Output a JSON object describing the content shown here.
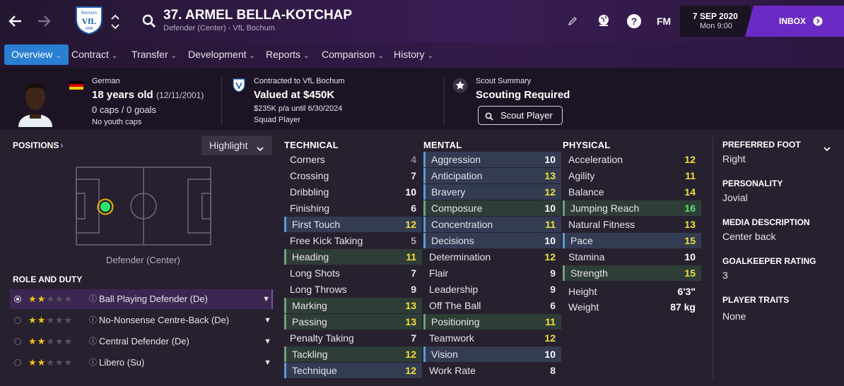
{
  "header": {
    "player_name": "37. ARMEL BELLA-KOTCHAP",
    "subtitle": "Defender (Center) - VfL Bochum",
    "fm_label": "FM",
    "date": "7 SEP 2020",
    "time": "Mon 9:00",
    "inbox_label": "INBOX",
    "club_crest_text_top": "Bochum",
    "club_crest_text_bottom": "1848",
    "club_crest_letters": "VfL"
  },
  "nav": {
    "tabs": [
      {
        "label": "Overview"
      },
      {
        "label": "Contract"
      },
      {
        "label": "Transfer"
      },
      {
        "label": "Development"
      },
      {
        "label": "Reports"
      },
      {
        "label": "Comparison"
      },
      {
        "label": "History"
      }
    ]
  },
  "info": {
    "nationality": "German",
    "age": "18 years old",
    "dob": "(12/11/2001)",
    "caps": "0 caps / 0 goals",
    "youth_caps": "No youth caps",
    "contract_to": "Contracted to VfL Bochum",
    "value": "Valued at $450K",
    "wage": "$235K p/a until 6/30/2024",
    "squad_status": "Squad Player",
    "scout_title": "Scout Summary",
    "scout_status": "Scouting Required",
    "scout_button": "Scout Player"
  },
  "positions": {
    "header": "POSITIONS",
    "highlight_label": "Highlight",
    "position_label": "Defender (Center)"
  },
  "role_duty": {
    "header": "ROLE AND DUTY",
    "rows": [
      {
        "label": "Ball Playing Defender (De)",
        "stars": 2
      },
      {
        "label": "No-Nonsense Centre-Back (De)",
        "stars": 2
      },
      {
        "label": "Central Defender (De)",
        "stars": 2
      },
      {
        "label": "Libero (Su)",
        "stars": 2
      }
    ]
  },
  "technical": {
    "header": "TECHNICAL",
    "attrs": [
      {
        "name": "Corners",
        "value": "4"
      },
      {
        "name": "Crossing",
        "value": "7"
      },
      {
        "name": "Dribbling",
        "value": "10"
      },
      {
        "name": "Finishing",
        "value": "6"
      },
      {
        "name": "First Touch",
        "value": "12"
      },
      {
        "name": "Free Kick Taking",
        "value": "5"
      },
      {
        "name": "Heading",
        "value": "11"
      },
      {
        "name": "Long Shots",
        "value": "7"
      },
      {
        "name": "Long Throws",
        "value": "9"
      },
      {
        "name": "Marking",
        "value": "13"
      },
      {
        "name": "Passing",
        "value": "13"
      },
      {
        "name": "Penalty Taking",
        "value": "7"
      },
      {
        "name": "Tackling",
        "value": "12"
      },
      {
        "name": "Technique",
        "value": "12"
      }
    ]
  },
  "mental": {
    "header": "MENTAL",
    "attrs": [
      {
        "name": "Aggression",
        "value": "10"
      },
      {
        "name": "Anticipation",
        "value": "13"
      },
      {
        "name": "Bravery",
        "value": "12"
      },
      {
        "name": "Composure",
        "value": "10"
      },
      {
        "name": "Concentration",
        "value": "11"
      },
      {
        "name": "Decisions",
        "value": "10"
      },
      {
        "name": "Determination",
        "value": "12"
      },
      {
        "name": "Flair",
        "value": "9"
      },
      {
        "name": "Leadership",
        "value": "9"
      },
      {
        "name": "Off The Ball",
        "value": "6"
      },
      {
        "name": "Positioning",
        "value": "11"
      },
      {
        "name": "Teamwork",
        "value": "12"
      },
      {
        "name": "Vision",
        "value": "10"
      },
      {
        "name": "Work Rate",
        "value": "8"
      }
    ]
  },
  "physical": {
    "header": "PHYSICAL",
    "attrs": [
      {
        "name": "Acceleration",
        "value": "12"
      },
      {
        "name": "Agility",
        "value": "11"
      },
      {
        "name": "Balance",
        "value": "14"
      },
      {
        "name": "Jumping Reach",
        "value": "16"
      },
      {
        "name": "Natural Fitness",
        "value": "13"
      },
      {
        "name": "Pace",
        "value": "15"
      },
      {
        "name": "Stamina",
        "value": "10"
      },
      {
        "name": "Strength",
        "value": "15"
      }
    ],
    "height_label": "Height",
    "height_value": "6'3\"",
    "weight_label": "Weight",
    "weight_value": "87 kg"
  },
  "side": {
    "foot_label": "PREFERRED FOOT",
    "foot_value": "Right",
    "personality_label": "PERSONALITY",
    "personality_value": "Jovial",
    "media_label": "MEDIA DESCRIPTION",
    "media_value": "Center back",
    "gk_label": "GOALKEEPER RATING",
    "gk_value": "3",
    "traits_label": "PLAYER TRAITS",
    "traits_value": "None"
  },
  "colors": {
    "accent_blue": "#2a7fd3",
    "inbox_purple": "#6a2bc4",
    "attr_yellow": "#f1e03c",
    "attr_green": "#4ee86a",
    "position_dot": "#2ee36b"
  }
}
